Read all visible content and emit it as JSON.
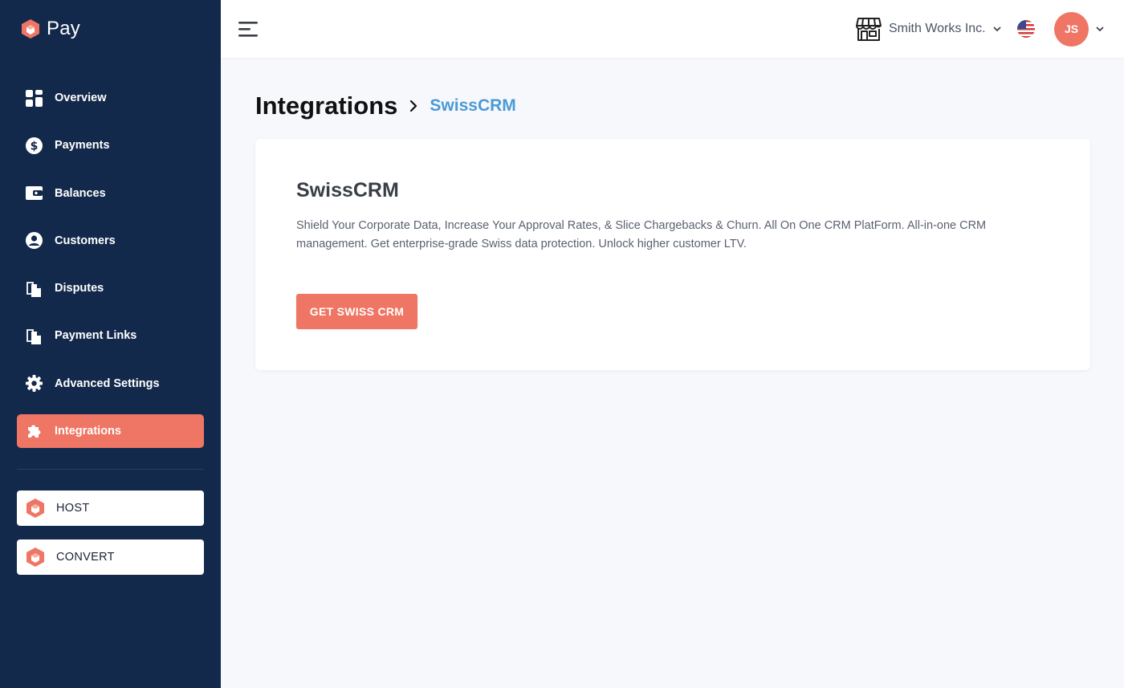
{
  "brand": {
    "name": "Pay",
    "accent": "#ef7564",
    "sidebar_bg": "#13294b",
    "link_color": "#4a9ad6"
  },
  "sidebar": {
    "items": [
      {
        "label": "Overview",
        "icon": "grid-icon"
      },
      {
        "label": "Payments",
        "icon": "dollar-circle-icon"
      },
      {
        "label": "Balances",
        "icon": "wallet-icon"
      },
      {
        "label": "Customers",
        "icon": "user-circle-icon"
      },
      {
        "label": "Disputes",
        "icon": "documents-icon"
      },
      {
        "label": "Payment Links",
        "icon": "documents-icon"
      },
      {
        "label": "Advanced Settings",
        "icon": "gear-icon"
      },
      {
        "label": "Integrations",
        "icon": "puzzle-icon",
        "active": true
      }
    ],
    "apps": [
      {
        "label": "HOST",
        "icon": "cube-logo-icon"
      },
      {
        "label": "CONVERT",
        "icon": "cube-logo-icon"
      }
    ]
  },
  "topbar": {
    "menu_icon": "hamburger-icon",
    "store_name": "Smith Works Inc.",
    "store_icon": "storefront-icon",
    "flag_icon": "us-flag-icon",
    "avatar_initials": "JS"
  },
  "breadcrumb": {
    "root": "Integrations",
    "current": "SwissCRM"
  },
  "card": {
    "title": "SwissCRM",
    "description": "Shield Your Corporate Data, Increase Your Approval Rates, & Slice Chargebacks & Churn. All On One CRM PlatForm. All-in-one CRM management. Get enterprise-grade Swiss data protection. Unlock higher customer LTV.",
    "cta_label": "GET SWISS CRM"
  }
}
